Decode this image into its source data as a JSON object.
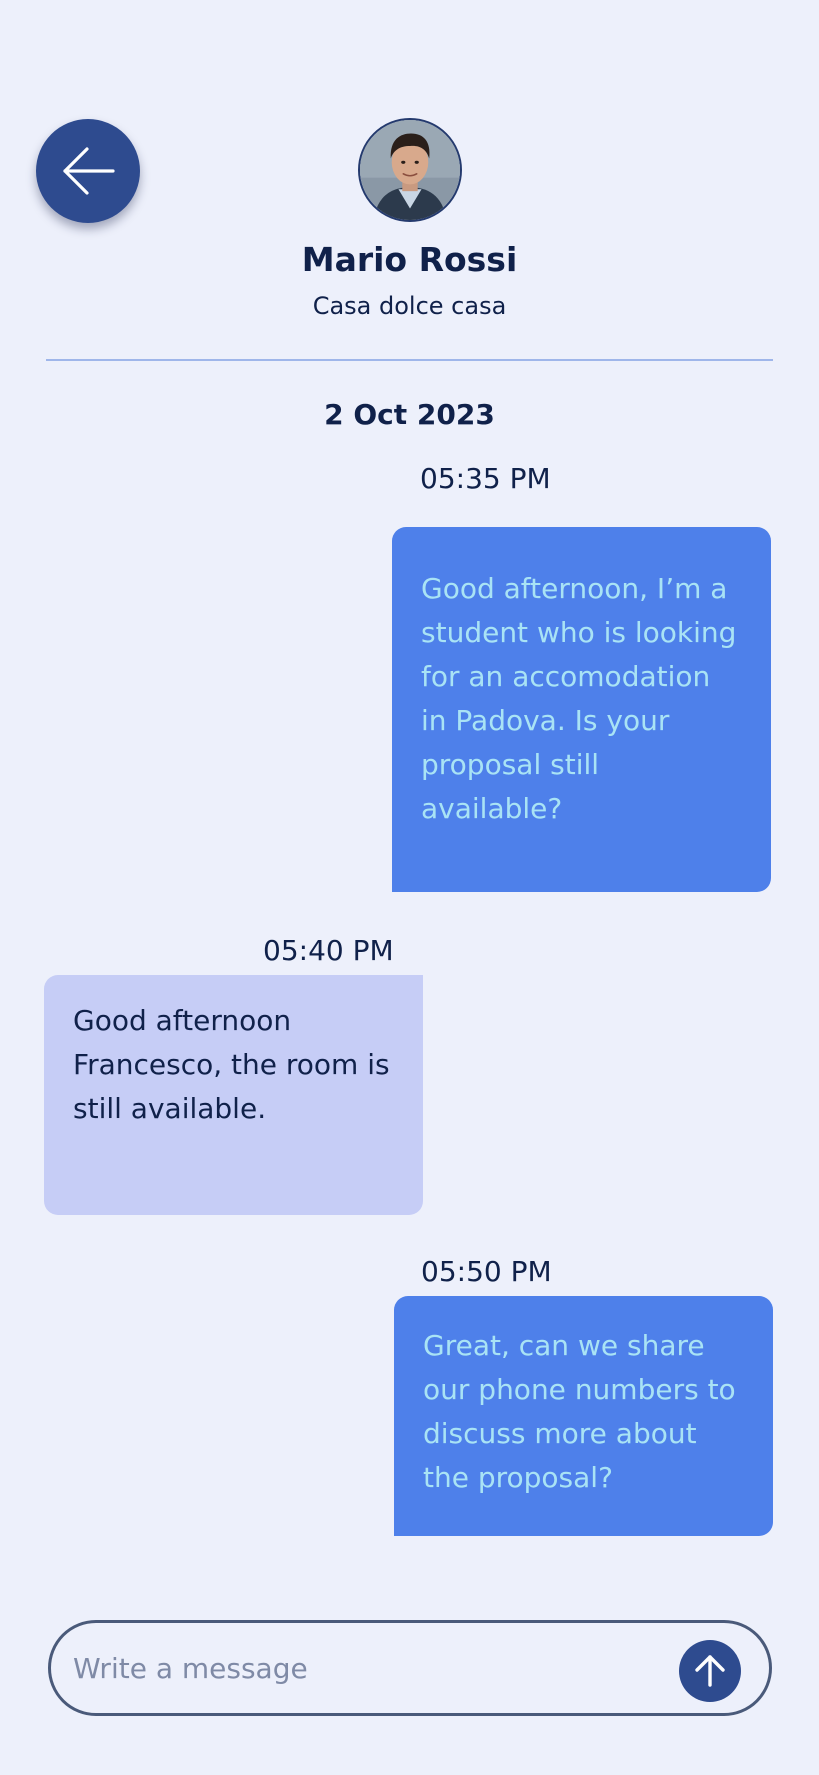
{
  "header": {
    "back_icon": "arrow-left-icon",
    "contact_name": "Mario Rossi",
    "contact_subtitle": "Casa dolce casa",
    "avatar_icon": "profile-photo"
  },
  "conversation": {
    "date": "2 Oct 2023",
    "messages": [
      {
        "direction": "outgoing",
        "time": "05:35 PM",
        "text": "Good afternoon, I’m a student who is looking for an accomodation in Padova. Is your proposal still available?"
      },
      {
        "direction": "incoming",
        "time": "05:40 PM",
        "text": "Good afternoon Francesco, the room is still available."
      },
      {
        "direction": "outgoing",
        "time": "05:50 PM",
        "text": "Great, can we share our phone numbers to discuss more about the proposal?"
      }
    ]
  },
  "composer": {
    "placeholder": "Write a message",
    "value": "",
    "send_icon": "arrow-up-icon"
  },
  "colors": {
    "background": "#edf0fb",
    "primary": "#2e4b8f",
    "outgoing_bubble": "#4e80ea",
    "outgoing_text": "#a9e3f5",
    "incoming_bubble": "#c6cdf6",
    "text": "#10214a"
  }
}
